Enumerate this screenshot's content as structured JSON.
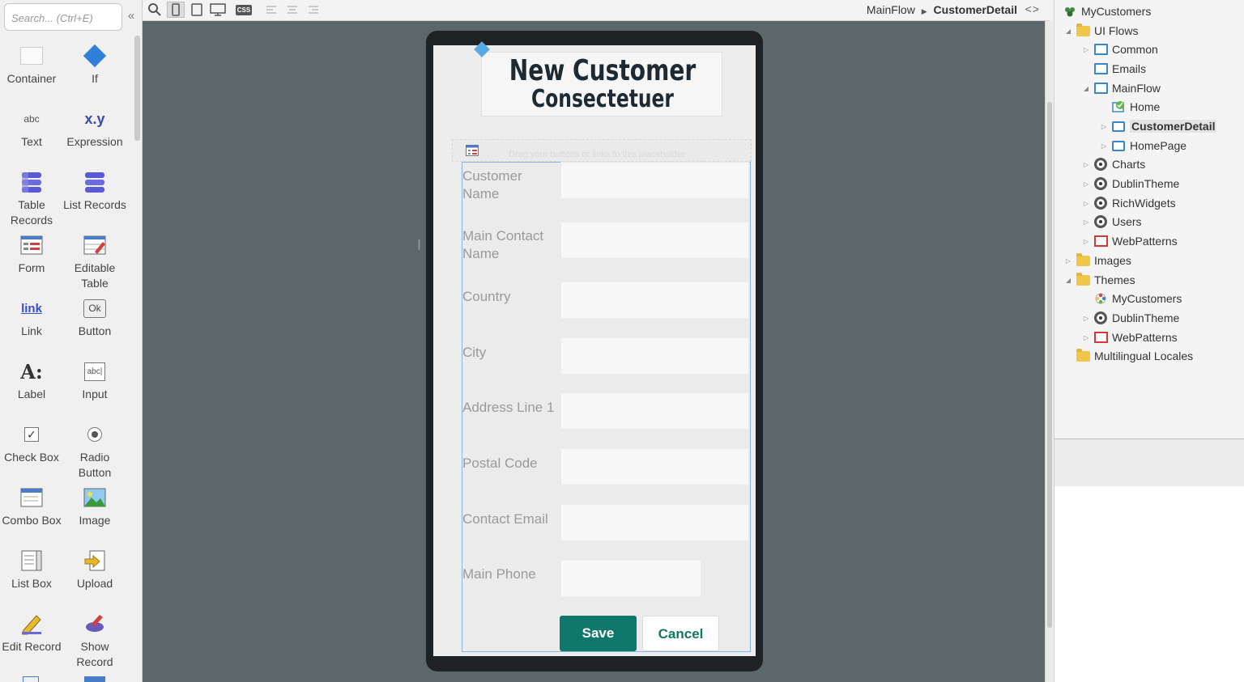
{
  "toolbox": {
    "search_placeholder": "Search... (Ctrl+E)",
    "tools": [
      {
        "label": "Container",
        "icon": "container-icon"
      },
      {
        "label": "If",
        "icon": "if-diamond-icon"
      },
      {
        "label": "Text",
        "icon": "text-abc-icon"
      },
      {
        "label": "Expression",
        "icon": "expression-xy-icon"
      },
      {
        "label": "Table Records",
        "icon": "table-records-icon"
      },
      {
        "label": "List Records",
        "icon": "list-records-icon"
      },
      {
        "label": "Form",
        "icon": "form-icon"
      },
      {
        "label": "Editable Table",
        "icon": "editable-table-icon"
      },
      {
        "label": "Link",
        "icon": "link-icon"
      },
      {
        "label": "Button",
        "icon": "button-ok-icon"
      },
      {
        "label": "Label",
        "icon": "label-icon"
      },
      {
        "label": "Input",
        "icon": "input-icon"
      },
      {
        "label": "Check Box",
        "icon": "check-box-icon"
      },
      {
        "label": "Radio Button",
        "icon": "radio-button-icon"
      },
      {
        "label": "Combo Box",
        "icon": "combo-box-icon"
      },
      {
        "label": "Image",
        "icon": "image-icon"
      },
      {
        "label": "List Box",
        "icon": "list-box-icon"
      },
      {
        "label": "Upload",
        "icon": "upload-icon"
      },
      {
        "label": "Edit Record",
        "icon": "edit-record-icon"
      },
      {
        "label": "Show Record",
        "icon": "show-record-icon"
      }
    ],
    "icon_texts": {
      "text": "abc",
      "expression": "x.y",
      "link": "link",
      "button": "Ok",
      "label": "A:",
      "input": "abc|"
    }
  },
  "topbar": {
    "breadcrumb_flow": "MainFlow",
    "breadcrumb_screen": "CustomerDetail",
    "code_toggle": "<>",
    "css_label": "CSS"
  },
  "screen": {
    "title": "New Customer",
    "subtitle": "Consectetuer Limited",
    "placeholder_text": "Drag your buttons or links to this placeholder",
    "fields": [
      {
        "label": "Customer Name"
      },
      {
        "label": "Main Contact Name"
      },
      {
        "label": "Country"
      },
      {
        "label": "City"
      },
      {
        "label": "Address Line 1"
      },
      {
        "label": "Postal Code"
      },
      {
        "label": "Contact Email"
      },
      {
        "label": "Main Phone"
      }
    ],
    "save_label": "Save",
    "cancel_label": "Cancel"
  },
  "tree": {
    "nodes": [
      {
        "label": "MyCustomers",
        "icon": "app-icon"
      },
      {
        "label": "UI Flows",
        "icon": "folder-icon"
      },
      {
        "label": "Common",
        "icon": "flow-icon"
      },
      {
        "label": "Emails",
        "icon": "flow-icon"
      },
      {
        "label": "MainFlow",
        "icon": "flow-icon"
      },
      {
        "label": "Home",
        "icon": "home-screen-icon"
      },
      {
        "label": "CustomerDetail",
        "icon": "screen-icon"
      },
      {
        "label": "HomePage",
        "icon": "screen-icon"
      },
      {
        "label": "Charts",
        "icon": "module-icon"
      },
      {
        "label": "DublinTheme",
        "icon": "module-icon"
      },
      {
        "label": "RichWidgets",
        "icon": "module-icon"
      },
      {
        "label": "Users",
        "icon": "module-icon"
      },
      {
        "label": "WebPatterns",
        "icon": "web-patterns-icon"
      },
      {
        "label": "Images",
        "icon": "folder-icon"
      },
      {
        "label": "Themes",
        "icon": "folder-icon"
      },
      {
        "label": "MyCustomers",
        "icon": "theme-icon"
      },
      {
        "label": "DublinTheme",
        "icon": "module-icon"
      },
      {
        "label": "WebPatterns",
        "icon": "web-patterns-icon"
      },
      {
        "label": "Multilingual Locales",
        "icon": "folder-icon"
      }
    ]
  }
}
